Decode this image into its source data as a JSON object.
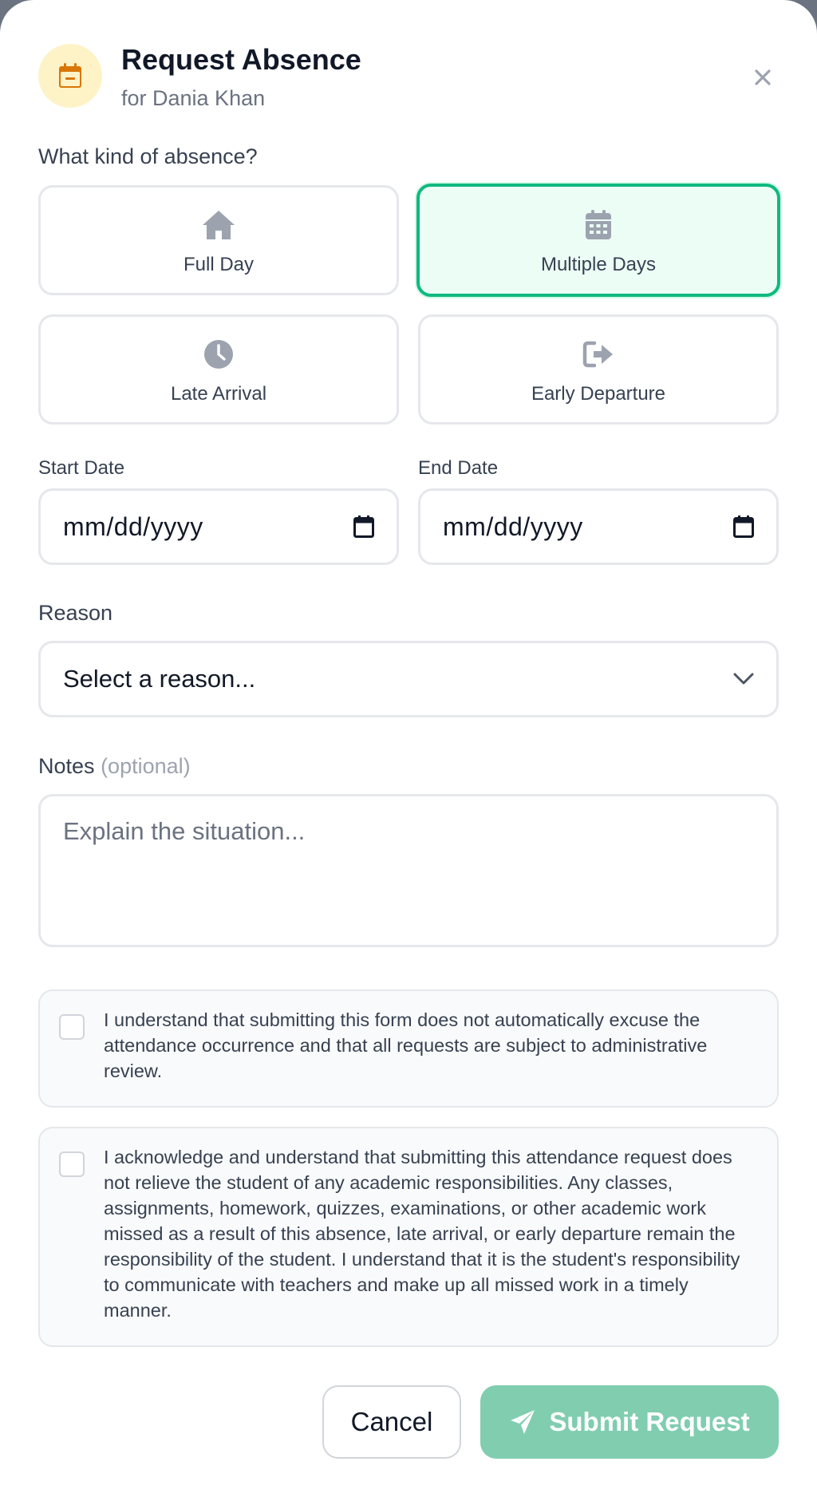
{
  "header": {
    "title": "Request Absence",
    "subtitle": "for Dania Khan",
    "icon": "calendar-minus-icon",
    "accent_color": "#d97706"
  },
  "absence_type": {
    "label": "What kind of absence?",
    "selected": "Multiple Days",
    "options": [
      {
        "label": "Full Day",
        "icon": "home-icon"
      },
      {
        "label": "Multiple Days",
        "icon": "calendar-icon"
      },
      {
        "label": "Late Arrival",
        "icon": "clock-icon"
      },
      {
        "label": "Early Departure",
        "icon": "sign-out-icon"
      }
    ]
  },
  "dates": {
    "start_label": "Start Date",
    "start_value": "mm/dd/yyyy",
    "end_label": "End Date",
    "end_value": "mm/dd/yyyy"
  },
  "reason": {
    "label": "Reason",
    "value": "Select a reason..."
  },
  "notes": {
    "label": "Notes",
    "optional": "(optional)",
    "placeholder": "Explain the situation..."
  },
  "acknowledgements": [
    {
      "text": "I understand that submitting this form does not automatically excuse the attendance occurrence and that all requests are subject to administrative review.",
      "checked": false
    },
    {
      "text": "I acknowledge and understand that submitting this attendance request does not relieve the student of any academic responsibilities. Any classes, assignments, homework, quizzes, examinations, or other academic work missed as a result of this absence, late arrival, or early departure remain the responsibility of the student. I understand that it is the student's responsibility to communicate with teachers and make up all missed work in a timely manner.",
      "checked": false
    }
  ],
  "actions": {
    "cancel_label": "Cancel",
    "submit_label": "Submit Request",
    "submit_color": "#80cdb0",
    "selected_color": "#10b981"
  }
}
